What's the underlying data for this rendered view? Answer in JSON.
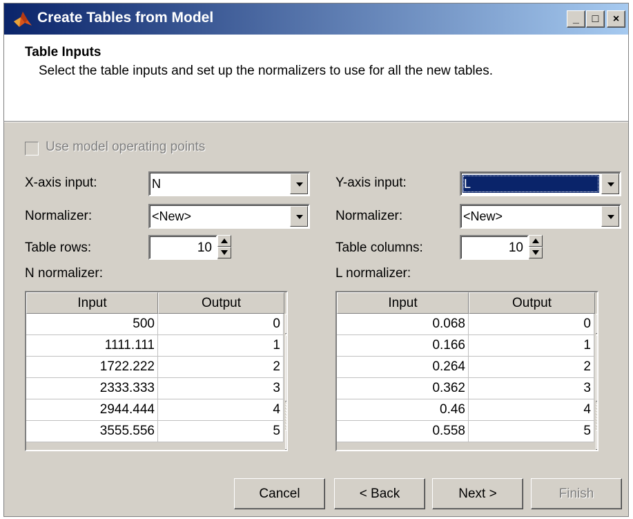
{
  "window": {
    "title": "Create Tables from Model",
    "minimize": "_",
    "maximize": "□",
    "close": "×"
  },
  "header": {
    "title": "Table Inputs",
    "subtitle": "Select the table inputs and set up the normalizers to use for all the new tables."
  },
  "options": {
    "use_operating_points_label": "Use model operating points",
    "use_operating_points_checked": false,
    "use_operating_points_enabled": false
  },
  "x_axis": {
    "input_label": "X-axis input:",
    "input_value": "N",
    "normalizer_label": "Normalizer:",
    "normalizer_value": "<New>",
    "count_label": "Table rows:",
    "count_value": "10",
    "table_label": "N normalizer:"
  },
  "y_axis": {
    "input_label": "Y-axis input:",
    "input_value": "L",
    "normalizer_label": "Normalizer:",
    "normalizer_value": "<New>",
    "count_label": "Table columns:",
    "count_value": "10",
    "table_label": "L normalizer:"
  },
  "n_table": {
    "columns": [
      "Input",
      "Output"
    ],
    "rows": [
      [
        "500",
        "0"
      ],
      [
        "1111.111",
        "1"
      ],
      [
        "1722.222",
        "2"
      ],
      [
        "2333.333",
        "3"
      ],
      [
        "2944.444",
        "4"
      ],
      [
        "3555.556",
        "5"
      ]
    ]
  },
  "l_table": {
    "columns": [
      "Input",
      "Output"
    ],
    "rows": [
      [
        "0.068",
        "0"
      ],
      [
        "0.166",
        "1"
      ],
      [
        "0.264",
        "2"
      ],
      [
        "0.362",
        "3"
      ],
      [
        "0.46",
        "4"
      ],
      [
        "0.558",
        "5"
      ]
    ]
  },
  "buttons": {
    "cancel": "Cancel",
    "back": "< Back",
    "next": "Next >",
    "finish": "Finish"
  }
}
